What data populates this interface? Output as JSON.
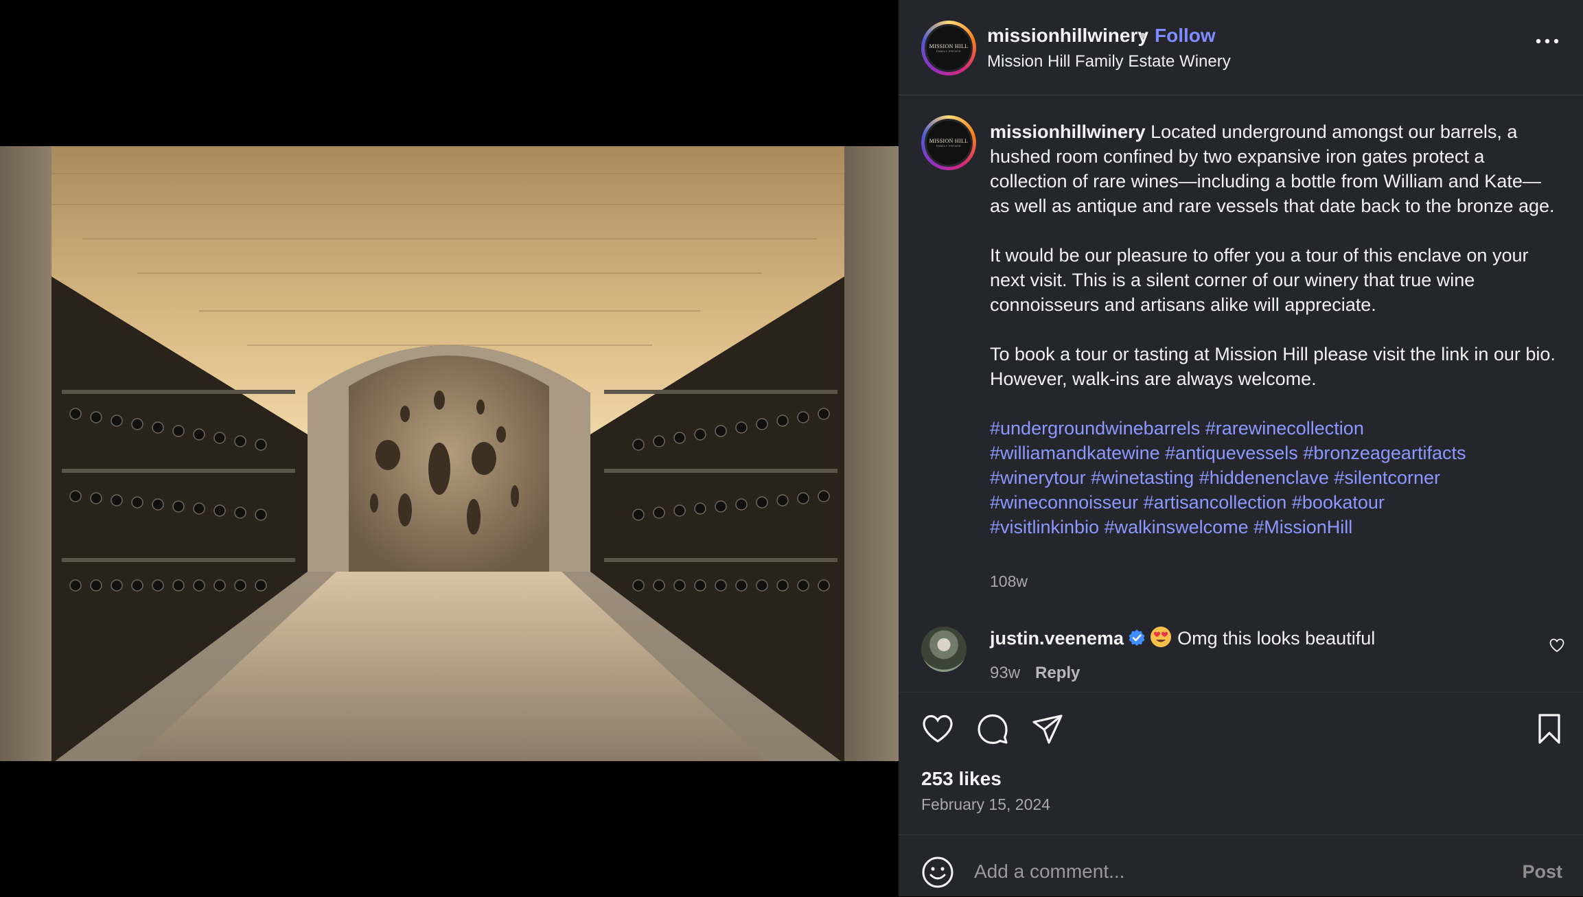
{
  "header": {
    "username": "missionhillwinery",
    "separator": "•",
    "follow_label": "Follow",
    "subtitle": "Mission Hill Family Estate Winery",
    "logo_text": "MISSION HILL",
    "logo_subtext": "FAMILY ESTATE"
  },
  "caption": {
    "username": "missionhillwinery",
    "paragraph1": "Located underground amongst our barrels, a hushed room confined by two expansive iron gates protect a collection of rare wines—including a bottle from William and Kate—as well as antique and rare vessels that date back to the bronze age.",
    "paragraph2": "It would be our pleasure to offer you a tour of this enclave on your next visit. This is a silent corner of our winery that true wine connoisseurs and artisans alike will appreciate.",
    "paragraph3": "To book a tour or tasting at Mission Hill please visit the link in our bio. However, walk-ins are always welcome.",
    "hashtags": [
      "#undergroundwinebarrels",
      "#rarewinecollection",
      "#williamandkatewine",
      "#antiquevessels",
      "#bronzeageartifacts",
      "#winerytour",
      "#winetasting",
      "#hiddenenclave",
      "#silentcorner",
      "#wineconnoisseur",
      "#artisancollection",
      "#bookatour",
      "#visitlinkinbio",
      "#walkinswelcome",
      "#MissionHill"
    ],
    "time": "108w"
  },
  "comment": {
    "username": "justin.veenema",
    "text": "Omg this looks beautiful",
    "time": "93w",
    "reply_label": "Reply"
  },
  "post_stats": {
    "likes": "253 likes",
    "date": "February 15, 2024"
  },
  "composer": {
    "placeholder": "Add a comment...",
    "post_label": "Post"
  },
  "icons": [
    "more-options-icon",
    "verified-badge-icon",
    "heart-eyes-emoji",
    "comment-like-icon",
    "like-icon",
    "comment-icon",
    "share-icon",
    "save-icon",
    "emoji-icon"
  ],
  "colors": {
    "panel_bg": "#25262b",
    "link": "#8c97ff",
    "follow": "#7f8cff"
  }
}
